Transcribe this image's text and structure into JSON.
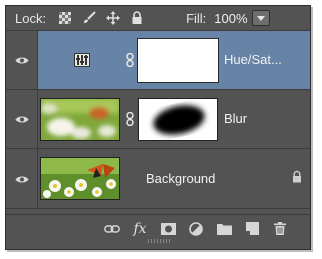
{
  "toolbar": {
    "lock_label": "Lock:",
    "fill_label": "Fill:",
    "fill_value": "100%"
  },
  "layers": [
    {
      "name": "Hue/Sat...",
      "selected": true,
      "type": "adjustment"
    },
    {
      "name": "Blur",
      "selected": false,
      "type": "smart"
    },
    {
      "name": "Background",
      "selected": false,
      "type": "background",
      "locked": true
    }
  ],
  "icons": {
    "lock_transparent": "checkerboard-icon",
    "lock_image": "brush-icon",
    "lock_position": "move-icon",
    "lock_all": "lock-icon",
    "eye": "eye-icon",
    "link": "chain-link-icon",
    "fx": "fx-icon",
    "mask": "add-mask-icon",
    "adjustment": "adjustment-icon",
    "group": "folder-icon",
    "new_layer": "new-layer-icon",
    "delete": "trash-icon"
  },
  "bottom_bar": {
    "fx_label": "fx"
  },
  "colors": {
    "panel": "#535353",
    "selected_row": "#6783a6"
  }
}
